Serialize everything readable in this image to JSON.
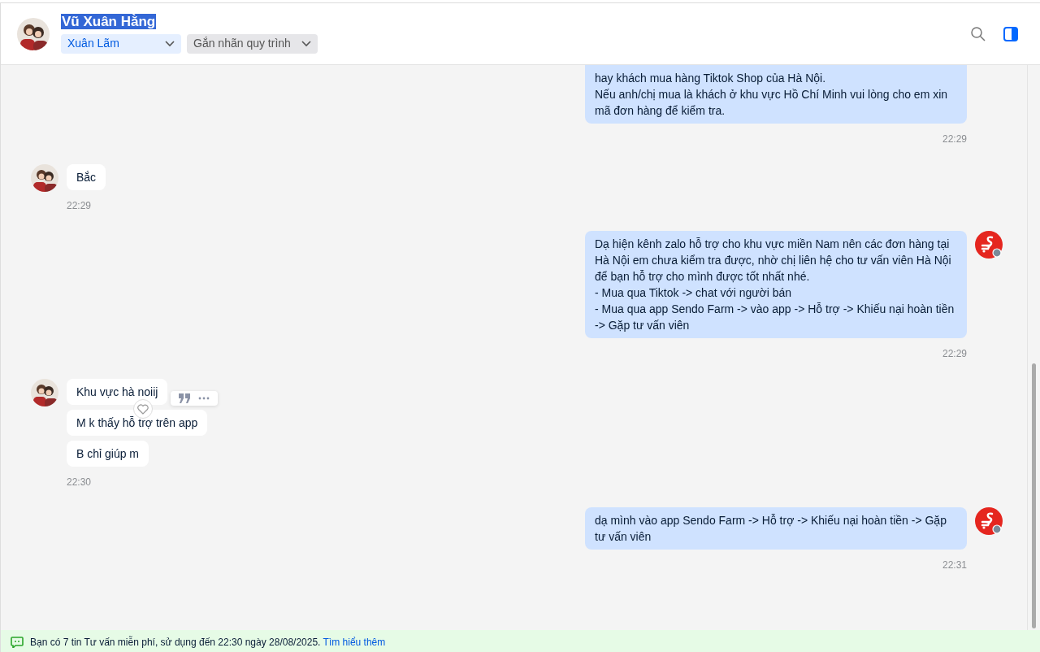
{
  "header": {
    "contact_name": "Vũ Xuân Hằng",
    "name_selected": true,
    "assignee": "Xuân Lãm",
    "tag_placeholder": "Gắn nhãn quy trình"
  },
  "messages": [
    {
      "kind": "outgoing",
      "messages": [
        {
          "text": "hay khách mua hàng Tiktok Shop của Hà Nội.\nNếu anh/chị mua là khách ở khu vực Hồ Chí Minh vui lòng cho em xin mã đơn hàng để kiểm tra.",
          "hovered": false
        }
      ],
      "time": "22:29",
      "avatar_shown": false
    },
    {
      "kind": "incoming",
      "messages": [
        {
          "text": "Bắc",
          "hovered": false
        }
      ],
      "time": "22:29",
      "avatar_shown": true
    },
    {
      "kind": "outgoing",
      "messages": [
        {
          "text": "Dạ hiện kênh zalo hỗ trợ cho khu vực miền Nam nên các đơn hàng tại Hà Nội em chưa kiểm tra được, nhờ chị liên hệ cho tư vấn viên Hà Nội để bạn hỗ trợ cho mình được tốt nhất nhé.\n- Mua qua Tiktok -> chat với người bán\n- Mua qua app Sendo Farm -> vào app -> Hỗ trợ -> Khiếu nại hoàn tiền -> Gặp tư vấn viên",
          "hovered": false
        }
      ],
      "time": "22:29",
      "avatar_shown": true
    },
    {
      "kind": "incoming",
      "messages": [
        {
          "text": "Khu vực hà noiij",
          "hovered": true
        },
        {
          "text": "M k thấy hỗ trợ trên app",
          "hovered": false
        },
        {
          "text": "B chỉ giúp m",
          "hovered": false
        }
      ],
      "time": "22:30",
      "avatar_shown": true
    },
    {
      "kind": "outgoing",
      "messages": [
        {
          "text": "dạ mình vào app Sendo Farm -> Hỗ trợ -> Khiếu nại hoàn tiền -> Gặp tư vấn viên",
          "hovered": false
        }
      ],
      "time": "22:31",
      "avatar_shown": true
    }
  ],
  "footer": {
    "text": "Bạn có 7 tin Tư vấn miễn phí, sử dụng đến 22:30 ngày 28/08/2025.",
    "link": "Tìm hiểu thêm"
  }
}
